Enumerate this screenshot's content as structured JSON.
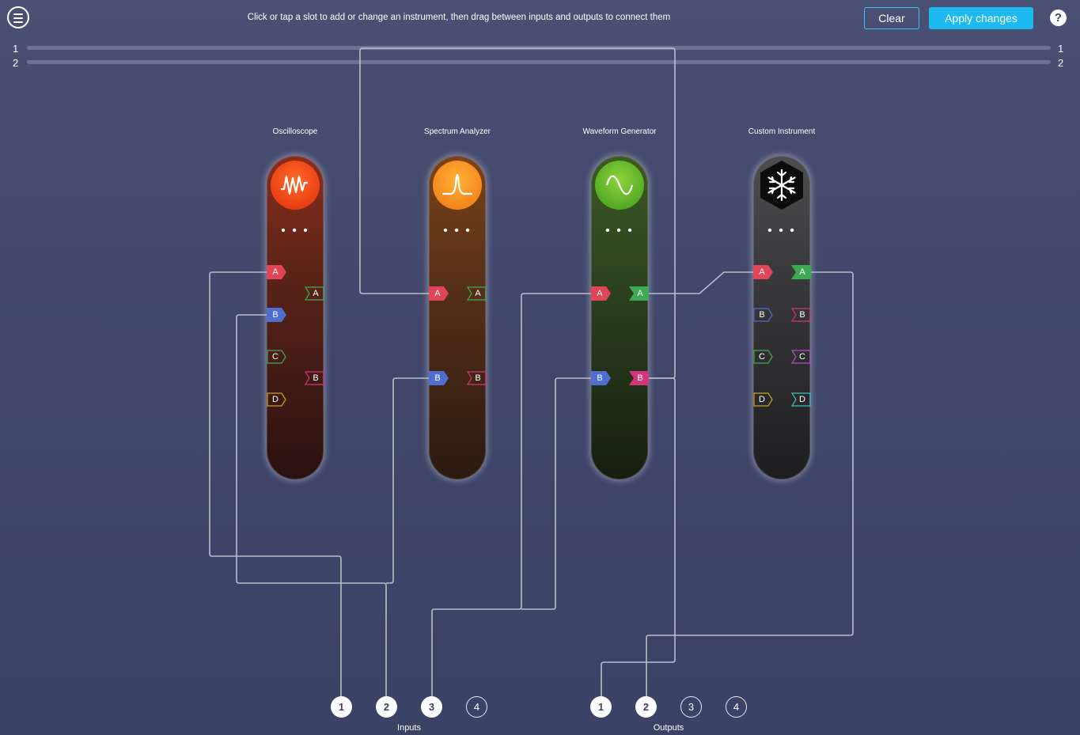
{
  "header": {
    "instructions": "Click or tap a slot to add or change an instrument, then drag between inputs and outputs to connect them",
    "clear_label": "Clear",
    "apply_label": "Apply changes",
    "help_label": "?",
    "accent": "#1fb9f2"
  },
  "rails": {
    "left_1": "1",
    "left_2": "2",
    "right_1": "1",
    "right_2": "2"
  },
  "instruments": [
    {
      "title": "Oscilloscope",
      "icon": "oscilloscope-icon",
      "color": "#e12d0a",
      "more": "• • •",
      "inputs": [
        "A",
        "B",
        "C",
        "D"
      ],
      "outputs": [
        "A",
        "B"
      ]
    },
    {
      "title": "Spectrum Analyzer",
      "icon": "spectrum-peak-icon",
      "color": "#f0750e",
      "more": "• • •",
      "inputs": [
        "A",
        "B"
      ],
      "outputs": [
        "A",
        "B"
      ]
    },
    {
      "title": "Waveform Generator",
      "icon": "sine-wave-icon",
      "color": "#3d9a1c",
      "more": "• • •",
      "inputs": [
        "A",
        "B"
      ],
      "outputs": [
        "A",
        "B"
      ]
    },
    {
      "title": "Custom Instrument",
      "icon": "snowflake-icon",
      "color": "#111111",
      "more": "• • •",
      "inputs": [
        "A",
        "B",
        "C",
        "D"
      ],
      "outputs": [
        "A",
        "B",
        "C",
        "D"
      ]
    }
  ],
  "inputs": {
    "label": "Inputs",
    "channels": [
      "1",
      "2",
      "3",
      "4"
    ],
    "connected": [
      "1",
      "2",
      "3"
    ]
  },
  "outputs": {
    "label": "Outputs",
    "channels": [
      "1",
      "2",
      "3",
      "4"
    ],
    "connected": [
      "1",
      "2"
    ]
  },
  "port_colors": {
    "A_in": "#e04558",
    "B_in": "#4f6fd0",
    "A_out": "#3faa55",
    "B_out": "#d0367a",
    "C": "#3faa55",
    "D": "#c9a227"
  }
}
